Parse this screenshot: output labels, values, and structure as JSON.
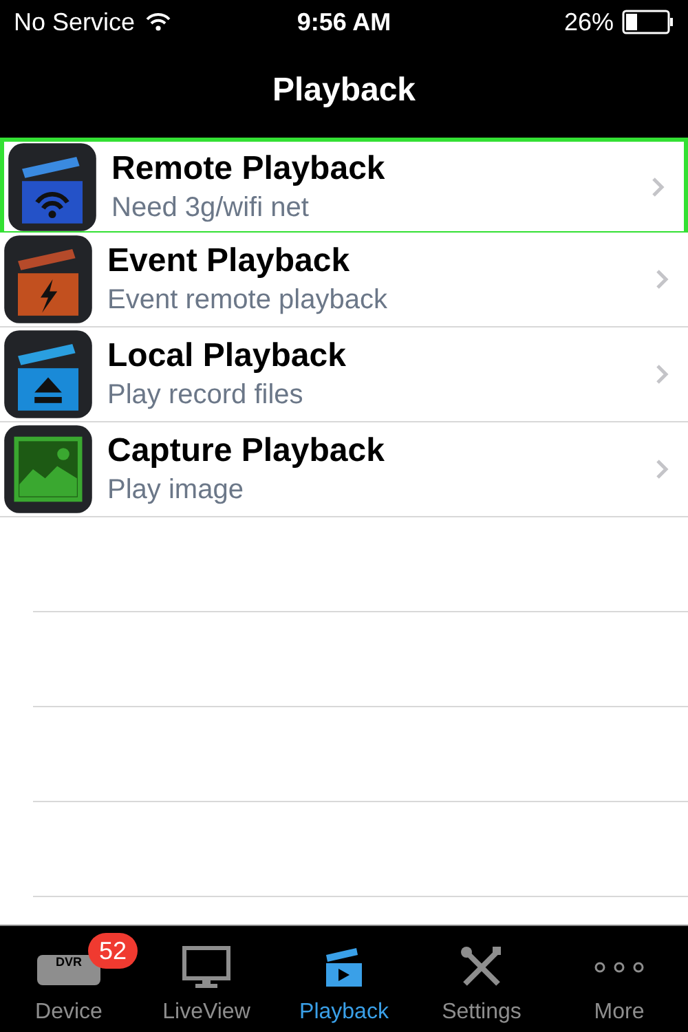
{
  "status_bar": {
    "carrier": "No Service",
    "time": "9:56 AM",
    "battery": "26%"
  },
  "nav_bar": {
    "title": "Playback"
  },
  "rows": [
    {
      "kind": "wifi",
      "title": "Remote Playback",
      "subtitle": "Need 3g/wifi net",
      "selected": true
    },
    {
      "kind": "bolt",
      "title": "Event Playback",
      "subtitle": "Event remote playback",
      "selected": false
    },
    {
      "kind": "eject",
      "title": "Local Playback",
      "subtitle": "Play record files",
      "selected": false
    },
    {
      "kind": "image",
      "title": "Capture Playback",
      "subtitle": "Play image",
      "selected": false
    }
  ],
  "tab_bar": [
    {
      "kind": "dvr",
      "label": "Device",
      "icon_text": "DVR",
      "badge": "52",
      "selected": false
    },
    {
      "kind": "monitor",
      "label": "LiveView",
      "selected": false
    },
    {
      "kind": "clapper",
      "label": "Playback",
      "selected": true
    },
    {
      "kind": "tools",
      "label": "Settings",
      "selected": false
    },
    {
      "kind": "more",
      "label": "More",
      "selected": false
    }
  ]
}
